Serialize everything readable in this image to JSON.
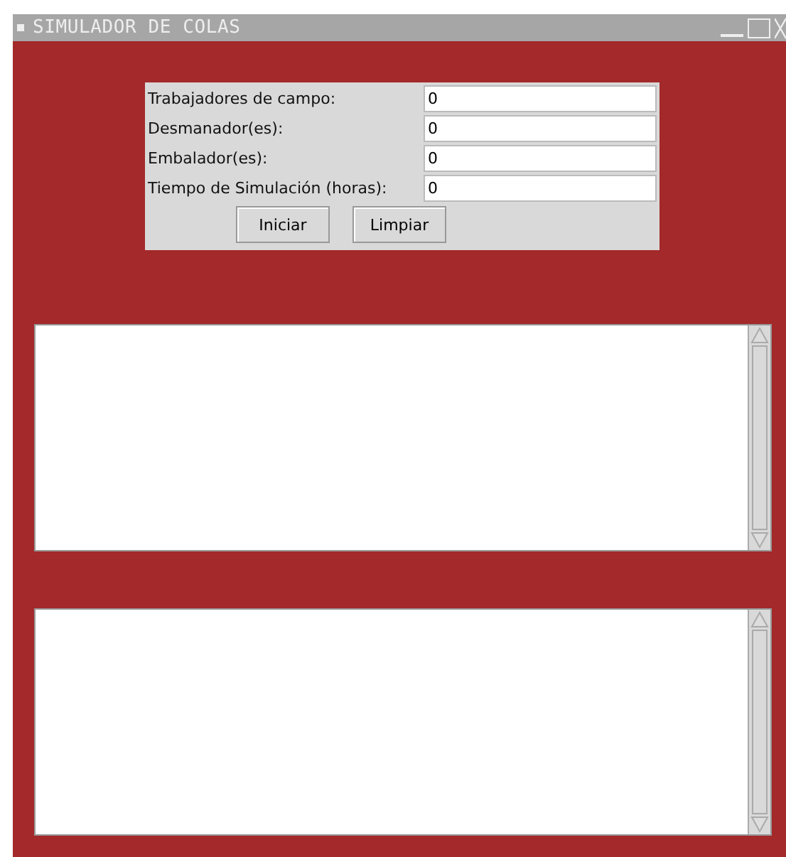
{
  "window": {
    "title": "SIMULADOR DE COLAS"
  },
  "form": {
    "fields": [
      {
        "label": "Trabajadores de campo:",
        "value": "0"
      },
      {
        "label": "Desmanador(es):",
        "value": "0"
      },
      {
        "label": "Embalador(es):",
        "value": "0"
      },
      {
        "label": "Tiempo de Simulación (horas):",
        "value": "0"
      }
    ],
    "buttons": [
      "Iniciar",
      "Limpiar"
    ]
  },
  "text_areas": [
    {
      "kind": "scrolled"
    },
    {
      "kind": "scrolled"
    }
  ]
}
